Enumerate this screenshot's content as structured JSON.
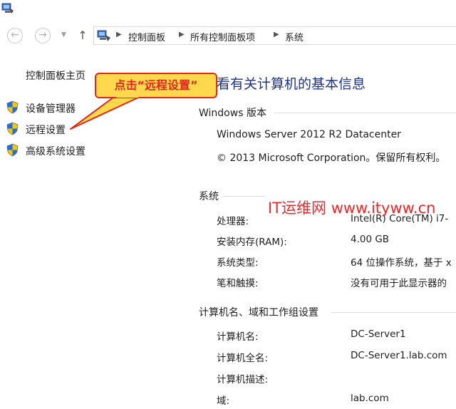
{
  "breadcrumb": [
    "控制面板",
    "所有控制面板项",
    "系统"
  ],
  "sidebar": {
    "home": "控制面板主页",
    "items": [
      {
        "label": "设备管理器",
        "icon": "uac-shield-icon"
      },
      {
        "label": "远程设置",
        "icon": "uac-shield-icon"
      },
      {
        "label": "高级系统设置",
        "icon": "uac-shield-icon"
      }
    ]
  },
  "callout": "点击“远程设置”",
  "main": {
    "title": "看有关计算机的基本信息",
    "edition": {
      "heading": "Windows 版本",
      "name": "Windows Server 2012 R2 Datacenter",
      "copyright": "© 2013 Microsoft Corporation。保留所有权利。"
    },
    "system": {
      "heading": "系统",
      "rows": [
        {
          "label": "处理器:",
          "value": "Intel(R) Core(TM) i7-"
        },
        {
          "label": "安装内存(RAM):",
          "value": "4.00 GB"
        },
        {
          "label": "系统类型:",
          "value": "64 位操作系统，基于 x"
        },
        {
          "label": "笔和触摸:",
          "value": "没有可用于此显示器的"
        }
      ]
    },
    "computer": {
      "heading": "计算机名、域和工作组设置",
      "rows": [
        {
          "label": "计算机名:",
          "value": "DC-Server1"
        },
        {
          "label": "计算机全名:",
          "value": "DC-Server1.lab.com"
        },
        {
          "label": "计算机描述:",
          "value": ""
        },
        {
          "label": "域:",
          "value": "lab.com"
        }
      ]
    }
  },
  "watermark": "IT运维网 www.ityww.cn",
  "colors": {
    "title": "#1e3287",
    "callout_fill": "#ffd84d",
    "callout_border": "#e0281a",
    "watermark": "#e8292b"
  }
}
